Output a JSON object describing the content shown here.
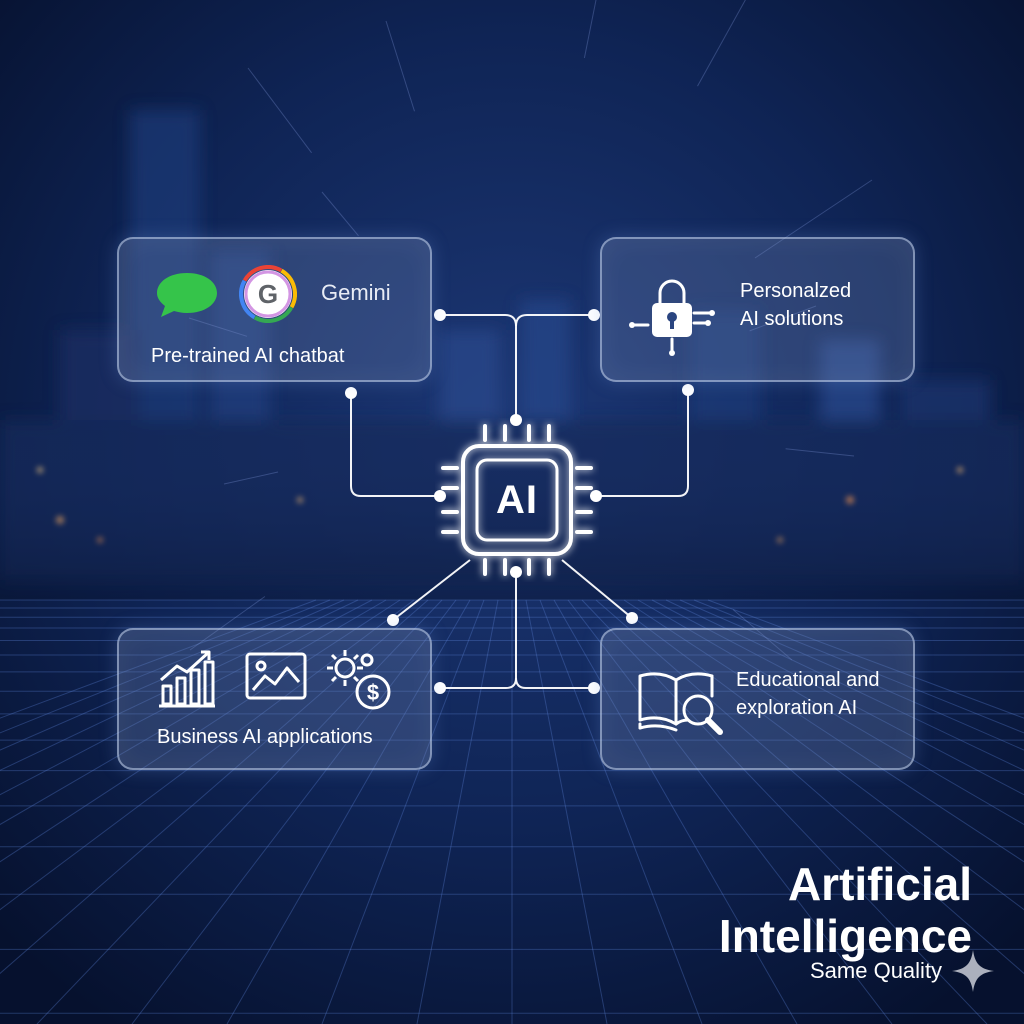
{
  "cards": {
    "top_left": {
      "brand": "Gemini",
      "label": "Pre-trained AI chatbat",
      "icons": [
        "chat-bubble-icon",
        "google-g-icon"
      ]
    },
    "top_right": {
      "label_line1": "Personalzed",
      "label_line2": "AI solutions",
      "icons": [
        "padlock-network-icon"
      ]
    },
    "bottom_left": {
      "label": "Business AI applications",
      "icons": [
        "bar-chart-growth-icon",
        "image-chart-icon",
        "gears-dollar-icon"
      ]
    },
    "bottom_right": {
      "label_line1": "Educational and",
      "label_line2": "exploration AI",
      "icons": [
        "book-magnifier-icon"
      ]
    }
  },
  "chip": {
    "label": "AI",
    "icon": "processor-chip-icon"
  },
  "branding": {
    "title_line1": "Artificial",
    "title_line2": "Intelligence",
    "subtitle": "Same Quality",
    "icon": "sparkle-icon"
  },
  "colors": {
    "background": "#0a1a3f",
    "wire": "#ffffff",
    "chat_green": "#34c34a"
  }
}
